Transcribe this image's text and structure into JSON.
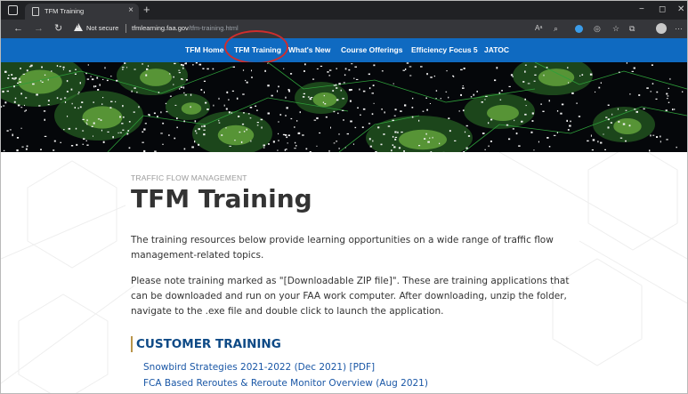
{
  "browser": {
    "tab_title": "TFM Training",
    "tab_close": "×",
    "new_tab": "+",
    "window_controls": {
      "minimize": "−",
      "restore": "◻",
      "close": "✕"
    },
    "security_label": "Not secure",
    "url_host": "tfmlearning.faa.gov",
    "url_path": "/tfm-training.html",
    "icons": [
      "window-icon",
      "page-icon",
      "back-icon",
      "forward-icon",
      "refresh-icon",
      "warning-icon",
      "read-aloud-icon",
      "zoom-icon",
      "extension-icon",
      "sidebar-icon",
      "favorites-icon",
      "collections-icon",
      "profile-icon",
      "more-icon"
    ]
  },
  "site_nav": {
    "items": [
      {
        "label": "TFM Home"
      },
      {
        "label": "TFM Training",
        "active": true
      },
      {
        "label": "What's New"
      },
      {
        "label": "Course Offerings"
      },
      {
        "label": "Efficiency Focus 5"
      },
      {
        "label": "JATOC"
      }
    ]
  },
  "main": {
    "eyebrow": "TRAFFIC FLOW MANAGEMENT",
    "title": "TFM Training",
    "intro": "The training resources below provide learning opportunities on a wide range of traffic flow management-related topics.",
    "note": "Please note training marked as \"[Downloadable ZIP file]\". These are training applications that can be downloaded and run on your FAA work computer. After downloading, unzip the folder, navigate to the .exe file and double click to launch the application.",
    "section_heading": "CUSTOMER TRAINING",
    "links": [
      {
        "label": "Snowbird Strategies 2021-2022 (Dec 2021) [PDF]"
      },
      {
        "label": "FCA Based Reroutes & Reroute Monitor Overview (Aug 2021)"
      }
    ]
  },
  "colors": {
    "nav_bar": "#0f6ac1",
    "section_heading": "#0e4a86",
    "section_rule": "#b9954a",
    "link": "#1a57a6",
    "highlight_circle": "#cf2d2d",
    "browser_chrome": "#202124"
  }
}
